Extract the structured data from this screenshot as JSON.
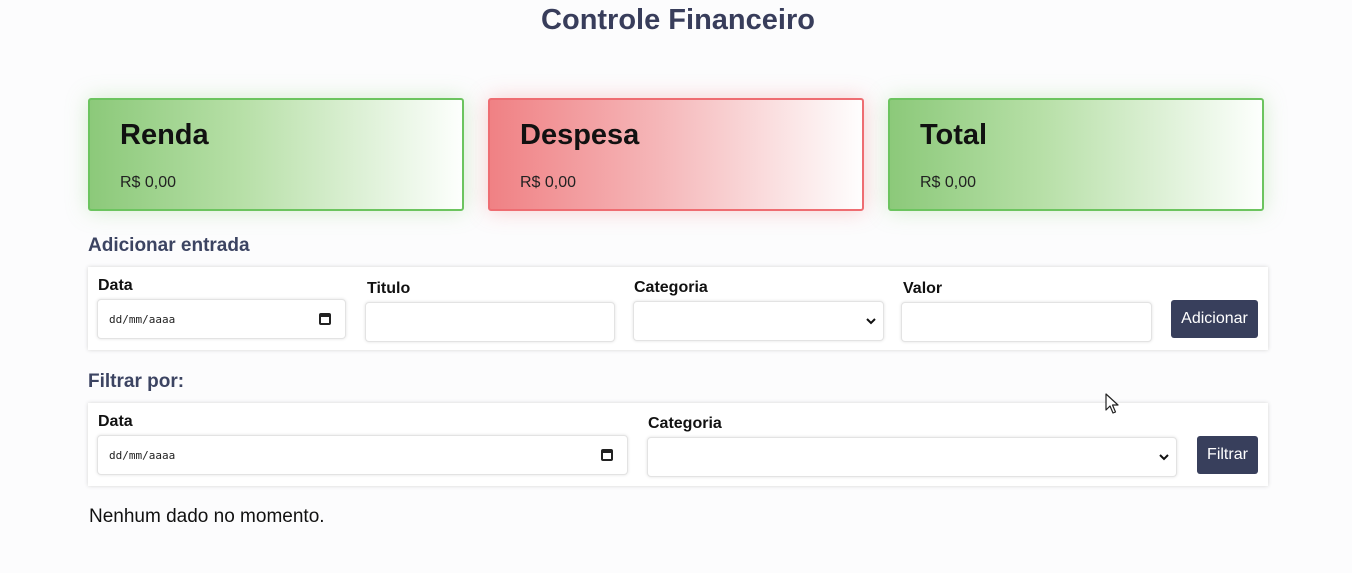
{
  "app": {
    "title": "Controle Financeiro"
  },
  "summary_cards": [
    {
      "title": "Renda",
      "value": "R$ 0,00",
      "color": "#8cc97a"
    },
    {
      "title": "Despesa",
      "value": "R$ 0,00",
      "color": "#f08184"
    },
    {
      "title": "Total",
      "value": "R$ 0,00",
      "color": "#8cc97a"
    }
  ],
  "add_entry": {
    "heading": "Adicionar entrada",
    "date_label": "Data",
    "date_placeholder": "dd/mm/aaaa",
    "title_label": "Titulo",
    "title_value": "",
    "category_label": "Categoria",
    "category_value": "",
    "value_label": "Valor",
    "value_value": "",
    "submit_label": "Adicionar"
  },
  "filter": {
    "heading": "Filtrar por:",
    "date_label": "Data",
    "date_placeholder": "dd/mm/aaaa",
    "category_label": "Categoria",
    "category_value": "",
    "submit_label": "Filtrar"
  },
  "empty_state": "Nenhum dado no momento.",
  "icons": {
    "calendar": "calendar-icon",
    "chevron": "chevron-down-icon",
    "cursor": "mouse-cursor-icon"
  },
  "colors": {
    "accent": "#383f5c",
    "income": "#6cc45f",
    "expense": "#ee6d72"
  }
}
